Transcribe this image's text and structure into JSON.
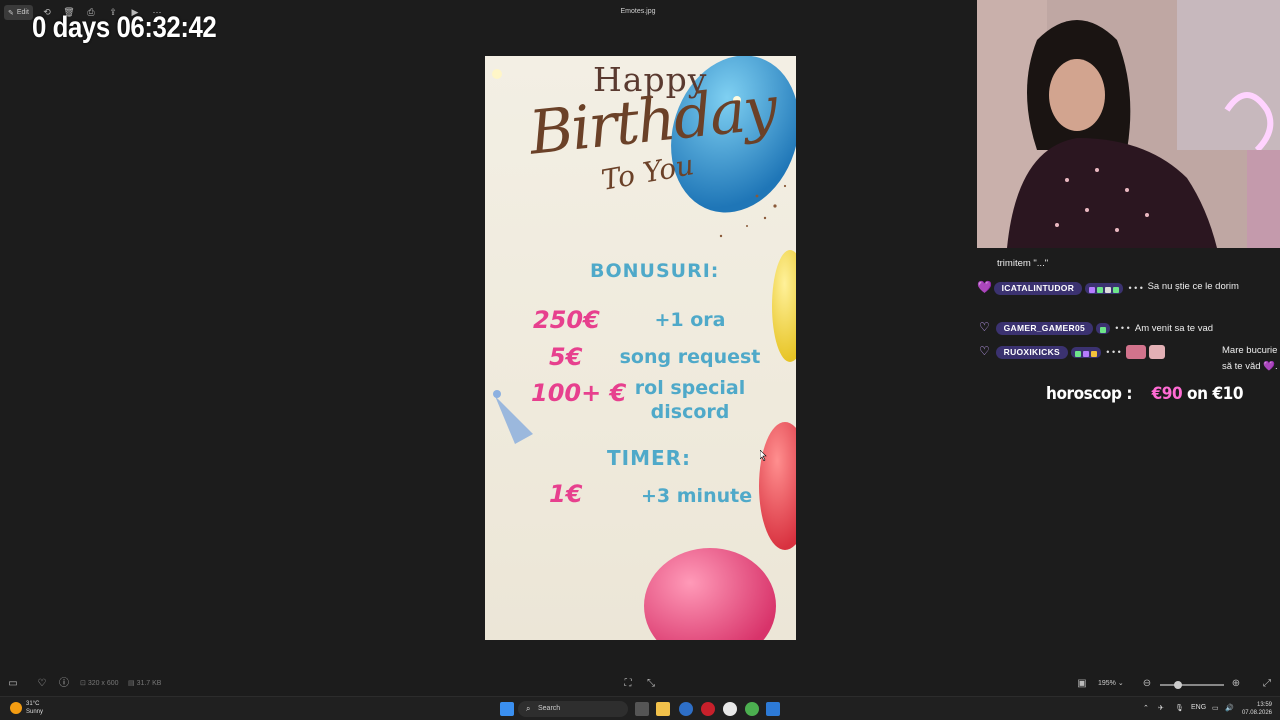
{
  "toolbar": {
    "edit_label": "Edit",
    "file_name": "Emotes.jpg"
  },
  "overlay": {
    "timer": "0 days 06:32:42"
  },
  "poster": {
    "happy": "Happy",
    "birthday": "Birthday",
    "to_you": "To You",
    "bonus_heading": "BONUSURI:",
    "bonuses": [
      {
        "price": "250€",
        "desc": "+1 ora"
      },
      {
        "price": "5€",
        "desc": "song request"
      },
      {
        "price": "100+ €",
        "desc": "rol special discord"
      }
    ],
    "timer_heading": "TIMER:",
    "timer_item": {
      "price": "1€",
      "desc": "+3 minute"
    }
  },
  "chat": {
    "messages": [
      {
        "user": "",
        "text": "trimitem \"...\""
      },
      {
        "user": "ICATALINTUDOR",
        "text": "Sa nu știe ce le dorim"
      },
      {
        "user": "GAMER_GAMER05",
        "text": "Am venit sa te vad"
      },
      {
        "user": "RUOXIKICKS",
        "text": "Mare bucurie să te văd 💜."
      }
    ]
  },
  "horoscope": {
    "label": "horoscop :",
    "price": "€90",
    "on": "on",
    "base": "€10"
  },
  "bottombar": {
    "dimensions": "320 x 600",
    "size": "31.7 KB",
    "zoom": "195%"
  },
  "taskbar": {
    "temperature": "31°C",
    "condition": "Sunny",
    "search_placeholder": "Search",
    "lang": "ENG",
    "time": "13:59",
    "date": "07.08.2026"
  },
  "colors": {
    "accent_pink": "#e7408e",
    "accent_blue": "#4fa9c9",
    "badge_purple": "#3b3270"
  }
}
